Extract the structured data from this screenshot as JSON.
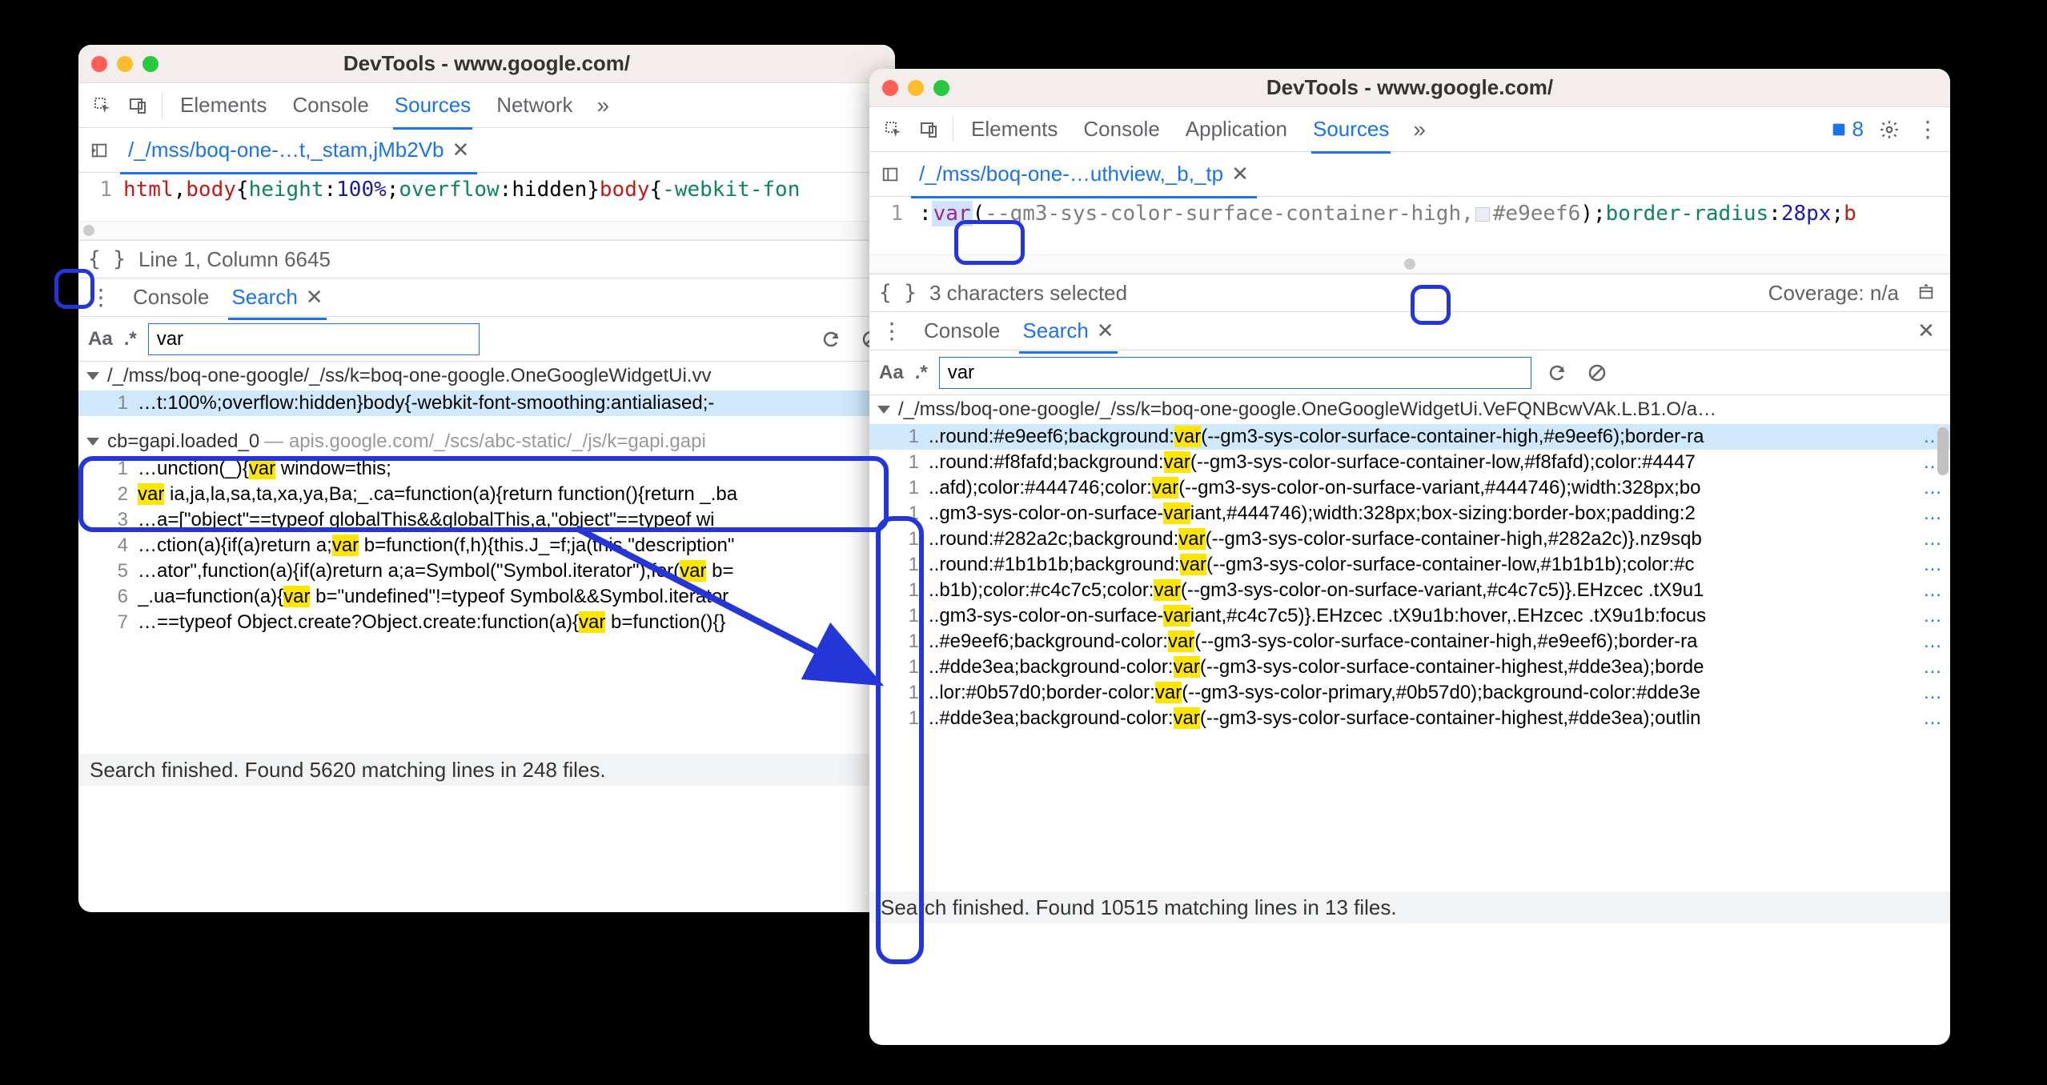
{
  "left": {
    "title": "DevTools - www.google.com/",
    "tabs": [
      "Elements",
      "Console",
      "Sources",
      "Network"
    ],
    "activeTab": "Sources",
    "fileTab": "/_/mss/boq-one-…t,_stam,jMb2Vb",
    "codeLineNo": "1",
    "codeLineParts": {
      "sel1": "html",
      "comma": ",",
      "sel2": "body",
      "brace1": "{",
      "prop1": "height",
      "colon1": ":",
      "val1": "100%",
      "semi1": ";",
      "prop2": "overflow",
      "colon2": ":",
      "val2": "hidden",
      "brace2": "}",
      "sel3": "body",
      "brace3": "{",
      "prop3": "-webkit-fon"
    },
    "status": "Line 1, Column 6645",
    "drawerTabs": [
      "Console",
      "Search"
    ],
    "activeDrawerTab": "Search",
    "searchValue": "var",
    "resultFile1": "/_/mss/boq-one-google/_/ss/k=boq-one-google.OneGoogleWidgetUi.vv",
    "resultLine1": {
      "ln": "1",
      "before": "…t:100%;overflow:hidden}body{-webkit-font-smoothing:antialiased;-"
    },
    "resultFile2": {
      "name": "cb=gapi.loaded_0",
      "sub": " — apis.google.com/_/scs/abc-static/_/js/k=gapi.gapi"
    },
    "lines2": [
      {
        "ln": "1",
        "pre": "…unction(_){",
        "hl": "var",
        "post": " window=this;"
      },
      {
        "ln": "2",
        "pre": "",
        "hl": "var",
        "post": " ia,ja,la,sa,ta,xa,ya,Ba;_.ca=function(a){return function(){return _.ba"
      },
      {
        "ln": "3",
        "pre": "…a=[\"object\"==typeof globalThis&&globalThis,a,\"object\"==typeof wi",
        "hl": "",
        "post": ""
      },
      {
        "ln": "4",
        "pre": "…ction(a){if(a)return a;",
        "hl": "var",
        "post": " b=function(f,h){this.J_=f;ja(this,\"description\""
      },
      {
        "ln": "5",
        "pre": "…ator\",function(a){if(a)return a;a=Symbol(\"Symbol.iterator\");for(",
        "hl": "var",
        "post": " b="
      },
      {
        "ln": "6",
        "pre": "_.ua=function(a){",
        "hl": "var",
        "post": " b=\"undefined\"!=typeof Symbol&&Symbol.iterator"
      },
      {
        "ln": "7",
        "pre": "…==typeof Object.create?Object.create:function(a){",
        "hl": "var",
        "post": " b=function(){}"
      }
    ],
    "bottomStatus": "Search finished.  Found 5620 matching lines in 248 files."
  },
  "right": {
    "title": "DevTools - www.google.com/",
    "tabs": [
      "Elements",
      "Console",
      "Application",
      "Sources"
    ],
    "activeTab": "Sources",
    "issuesCount": "8",
    "fileTab": "/_/mss/boq-one-…uthview,_b,_tp",
    "codeLineNo": "1",
    "codeParts": {
      "colon": ":",
      "fn": "var",
      "paren1": "(",
      "arg": "--gm3-sys-color-surface-container-high,",
      "hex": "#e9eef6",
      "paren2": ")",
      "semi": ";",
      "prop": "border-radius",
      "colon2": ":",
      "val": "28px",
      "semi2": ";",
      "trail": "b"
    },
    "status": "3 characters selected",
    "coverage": "Coverage: n/a",
    "drawerTabs": [
      "Console",
      "Search"
    ],
    "activeDrawerTab": "Search",
    "searchValue": "var",
    "resultFile1": "/_/mss/boq-one-google/_/ss/k=boq-one-google.OneGoogleWidgetUi.VeFQNBcwVAk.L.B1.O/a…",
    "lines": [
      {
        "ln": "1",
        "pre": "..round:#e9eef6;background:",
        "hl": "var",
        "post": "(--gm3-sys-color-surface-container-high,#e9eef6);border-ra",
        "selected": true
      },
      {
        "ln": "1",
        "pre": "..round:#f8fafd;background:",
        "hl": "var",
        "post": "(--gm3-sys-color-surface-container-low,#f8fafd);color:#4447"
      },
      {
        "ln": "1",
        "pre": "..afd);color:#444746;color:",
        "hl": "var",
        "post": "(--gm3-sys-color-on-surface-variant,#444746);width:328px;bo"
      },
      {
        "ln": "1",
        "pre": "..gm3-sys-color-on-surface-",
        "hl": "var",
        "post": "iant,#444746);width:328px;box-sizing:border-box;padding:2"
      },
      {
        "ln": "1",
        "pre": "..round:#282a2c;background:",
        "hl": "var",
        "post": "(--gm3-sys-color-surface-container-high,#282a2c)}.nz9sqb"
      },
      {
        "ln": "1",
        "pre": "..round:#1b1b1b;background:",
        "hl": "var",
        "post": "(--gm3-sys-color-surface-container-low,#1b1b1b);color:#c"
      },
      {
        "ln": "1",
        "pre": "..b1b);color:#c4c7c5;color:",
        "hl": "var",
        "post": "(--gm3-sys-color-on-surface-variant,#c4c7c5)}.EHzcec .tX9u1"
      },
      {
        "ln": "1",
        "pre": "..gm3-sys-color-on-surface-",
        "hl": "var",
        "post": "iant,#c4c7c5)}.EHzcec .tX9u1b:hover,.EHzcec .tX9u1b:focus"
      },
      {
        "ln": "1",
        "pre": "..#e9eef6;background-color:",
        "hl": "var",
        "post": "(--gm3-sys-color-surface-container-high,#e9eef6);border-ra"
      },
      {
        "ln": "1",
        "pre": "..#dde3ea;background-color:",
        "hl": "var",
        "post": "(--gm3-sys-color-surface-container-highest,#dde3ea);borde"
      },
      {
        "ln": "1",
        "pre": "..lor:#0b57d0;border-color:",
        "hl": "var",
        "post": "(--gm3-sys-color-primary,#0b57d0);background-color:#dde3e"
      },
      {
        "ln": "1",
        "pre": "..#dde3ea;background-color:",
        "hl": "var",
        "post": "(--gm3-sys-color-surface-container-highest,#dde3ea);outlin"
      }
    ],
    "bottomStatus": "Search finished.  Found 10515 matching lines in 13 files."
  }
}
